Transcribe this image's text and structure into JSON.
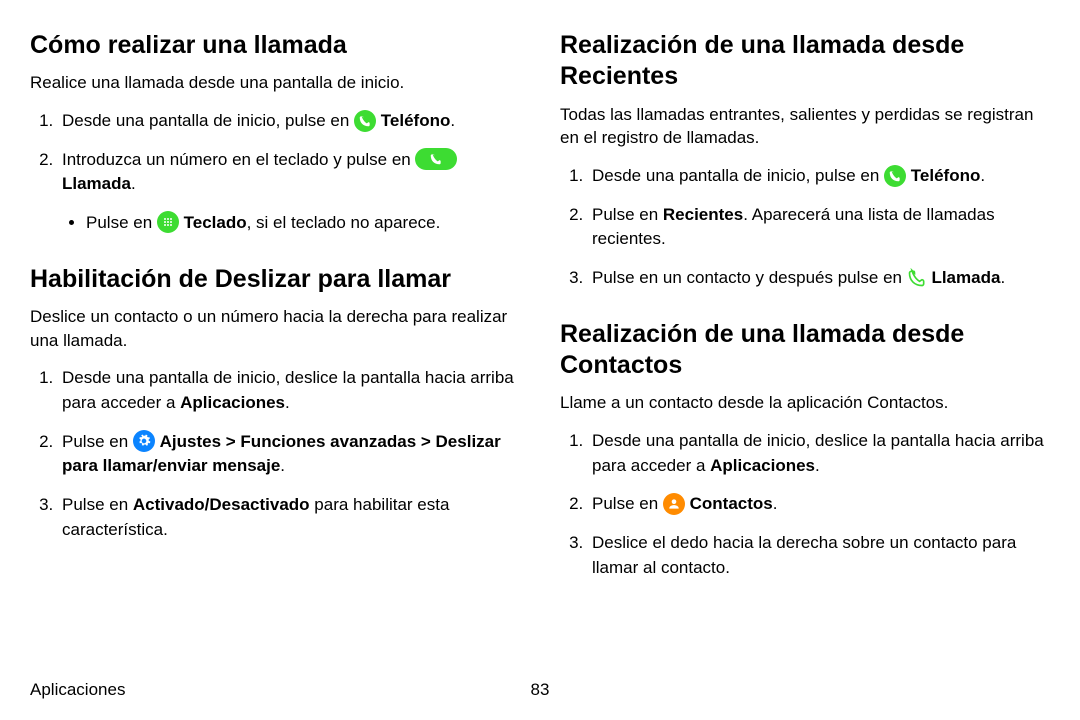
{
  "left": {
    "sec1": {
      "heading": "Cómo realizar una llamada",
      "intro": "Realice una llamada desde una pantalla de inicio.",
      "step1_a": "Desde una pantalla de inicio, pulse en ",
      "step1_b": "Teléfono",
      "step1_c": ".",
      "step2_a": "Introduzca un número en el teclado y pulse en ",
      "step2_b": "Llamada",
      "step2_c": ".",
      "step2_sub_a": "Pulse en ",
      "step2_sub_b": "Teclado",
      "step2_sub_c": ", si el teclado no aparece."
    },
    "sec2": {
      "heading": "Habilitación de Deslizar para llamar",
      "intro": "Deslice un contacto o un número hacia la derecha para realizar una llamada.",
      "step1_a": "Desde una pantalla de inicio, deslice la pantalla hacia arriba para acceder a ",
      "step1_b": "Aplicaciones",
      "step1_c": ".",
      "step2_a": "Pulse en ",
      "step2_b": "Ajustes",
      "step2_c": " > ",
      "step2_d": "Funciones avanzadas",
      "step2_e": " > ",
      "step2_f": "Deslizar para llamar/enviar mensaje",
      "step2_g": ".",
      "step3_a": "Pulse en ",
      "step3_b": "Activado/Desactivado",
      "step3_c": " para habilitar esta característica."
    }
  },
  "right": {
    "sec1": {
      "heading": "Realización de una llamada desde Recientes",
      "intro": "Todas las llamadas entrantes, salientes y perdidas se registran en el registro de llamadas.",
      "step1_a": "Desde una pantalla de inicio, pulse en ",
      "step1_b": "Teléfono",
      "step1_c": ".",
      "step2_a": "Pulse en ",
      "step2_b": "Recientes",
      "step2_c": ". Aparecerá una lista de llamadas recientes.",
      "step3_a": "Pulse en un contacto y después pulse en ",
      "step3_b": "Llamada",
      "step3_c": "."
    },
    "sec2": {
      "heading": "Realización de una llamada desde Contactos",
      "intro": "Llame a un contacto desde la aplicación Contactos.",
      "step1_a": "Desde una pantalla de inicio, deslice la pantalla hacia arriba para acceder a ",
      "step1_b": "Aplicaciones",
      "step1_c": ".",
      "step2_a": "Pulse en ",
      "step2_b": "Contactos",
      "step2_c": ".",
      "step3": "Deslice el dedo hacia la derecha sobre un contacto para llamar al contacto."
    }
  },
  "footer": {
    "section": "Aplicaciones",
    "page": "83"
  }
}
